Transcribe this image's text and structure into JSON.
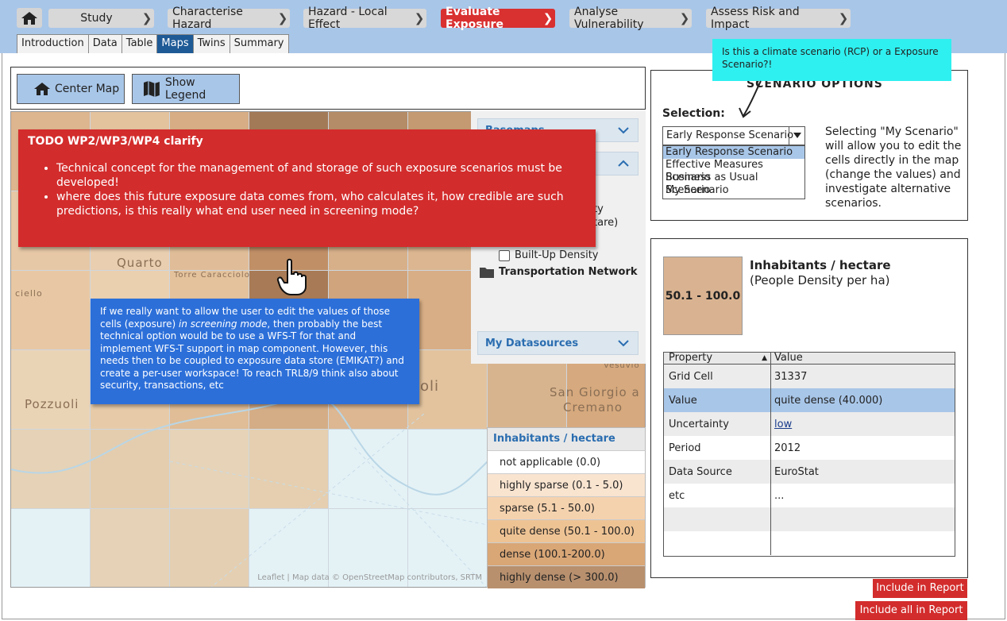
{
  "breadcrumbs": [
    {
      "label": "Study"
    },
    {
      "label": "Characterise Hazard"
    },
    {
      "label": "Hazard - Local Effect"
    },
    {
      "label": "Evaluate Exposure"
    },
    {
      "label": "Analyse Vulnerability"
    },
    {
      "label": "Assess Risk and Impact"
    }
  ],
  "tabs": [
    "Introduction",
    "Data",
    "Table",
    "Maps",
    "Twins",
    "Summary"
  ],
  "toolbar": {
    "center_map": "Center Map",
    "show_legend": "Show Legend"
  },
  "map": {
    "labels": [
      "Quarto",
      "Pozzuoli",
      "San Giorgio a",
      "Cremano",
      "Vesuvio",
      "oli",
      "ciello",
      "Torre Caracciolo"
    ],
    "attribution": "Leaflet | Map data © OpenStreetMap contributors, SRTM"
  },
  "layers": {
    "acc_top": "Basemaps",
    "rows_partial": [
      "ty",
      "tare)"
    ],
    "built_up": "Built-Up Density",
    "transport": "Transportation Network",
    "my_datasources": "My Datasources"
  },
  "legend": {
    "title": "Inhabitants / hectare",
    "items": [
      "not applicable (0.0)",
      "highly sparse (0.1 - 5.0)",
      "sparse (5.1 - 50.0)",
      "quite dense (50.1 - 100.0)",
      "dense (100.1-200.0)",
      "highly dense (> 300.0)"
    ],
    "colors": [
      "#ffffff",
      "#f9e4d0",
      "#f5d2ae",
      "#eec394",
      "#d9a676",
      "#b8906e"
    ]
  },
  "notes": {
    "red_title": "TODO WP2/WP3/WP4 clarify",
    "red_items": [
      "Technical concept for the management of and storage of such exposure scenarios must be developed!",
      "where does this future exposure data comes from, who calculates it, how credible are such predictions, is this really what end user need in screening mode?"
    ],
    "blue_1": "If we really want to allow the user to edit the values of those cells (exposure) ",
    "blue_em": "in screening mode",
    "blue_2": ", then probably the best technical option would be to use a WFS-T for that and implement WFS-T support in map component. However, this needs then to be coupled to exposure data store (EMIKAT?) and create a per-user workspace! To reach TRL8/9 think also about security, transactions, etc",
    "cyan": "Is this a climate scenario (RCP) or a Exposure Scenario?!"
  },
  "scenario": {
    "title": "SCENARIO OPTIONS",
    "selection_label": "Selection:",
    "selected": "Early Response Scenario",
    "options": [
      "Early Response Scenario",
      "Effective Measures Scenario",
      "Business as Usual Scenario",
      "My Scenario"
    ],
    "description": "Selecting \"My Scenario\" will allow you to edit the cells directly in the map (change the values) and investigate alternative scenarios."
  },
  "details": {
    "swatch_value": "50.1 - 100.0",
    "title": "Inhabitants / hectare",
    "subtitle": "(People Density per ha)",
    "col_property": "Property",
    "col_value": "Value",
    "rows": [
      {
        "property": "Grid Cell",
        "value": "31337"
      },
      {
        "property": "Value",
        "value": "quite dense (40.000)"
      },
      {
        "property": "Uncertainty",
        "value": "low"
      },
      {
        "property": "Period",
        "value": "2012"
      },
      {
        "property": "Data Source",
        "value": "EuroStat"
      },
      {
        "property": "etc",
        "value": "..."
      }
    ]
  },
  "buttons": {
    "include_report": "Include in Report",
    "include_all_report": "Include all in Report"
  }
}
